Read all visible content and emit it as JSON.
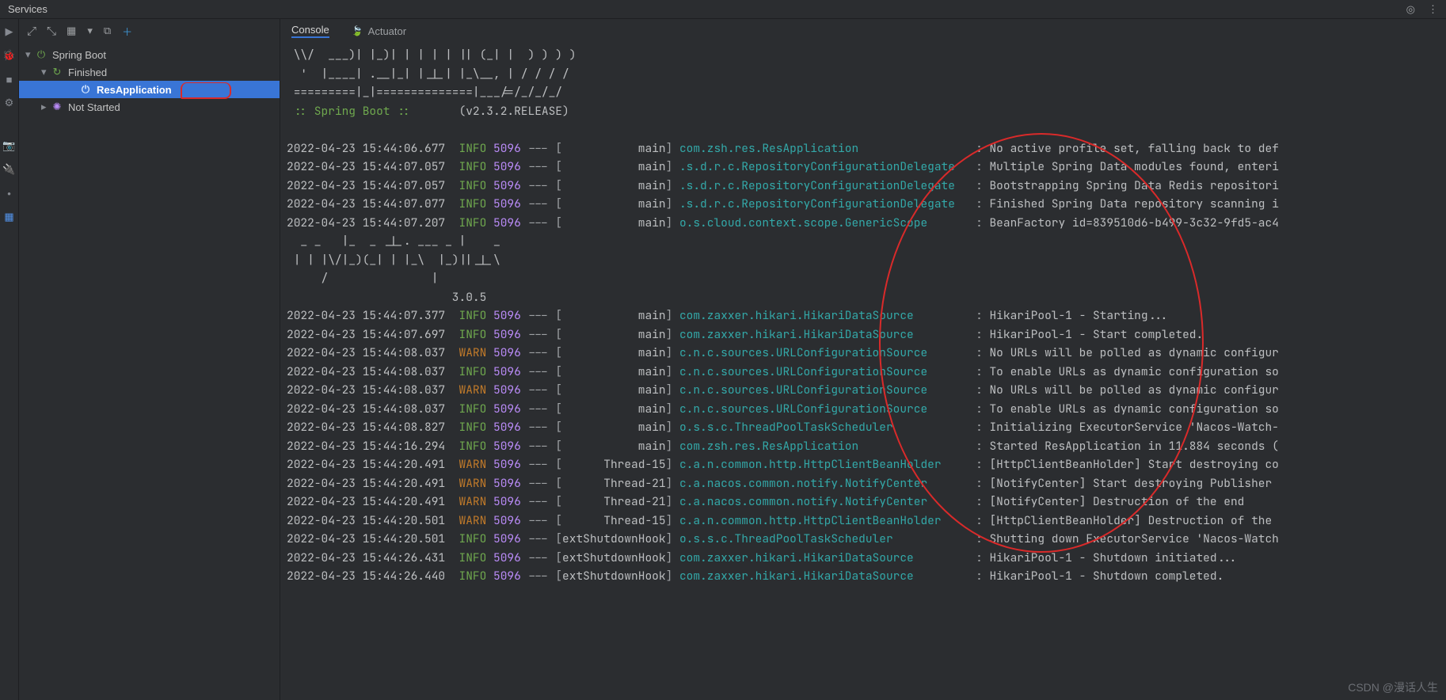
{
  "title": "Services",
  "tabs": {
    "console": "Console",
    "actuator": "Actuator"
  },
  "tree": {
    "spring_boot": "Spring Boot",
    "finished": "Finished",
    "res_app": "ResApplication",
    "not_started": "Not Started"
  },
  "banner": {
    "l1": " \\\\/  ___)| |_)| | | | | || (_| |  ) ) ) )",
    "l2": "  '  |____| .__|_| |_|_| |_\\__, | / / / /",
    "l3": " =========|_|==============|___/=/_/_/_/",
    "l4a": " :: Spring Boot :: ",
    "l4b": "      (v2.3.2.RELEASE)",
    "a1": "  _ _   |_  _ _|_. ___ _ |    _ ",
    "a2": " | | |\\/|_)(_| | |_\\  |_)||_|_\\ ",
    "a3": "     /               |         ",
    "a4": "                        3.0.5 "
  },
  "logs": [
    {
      "ts": "2022-04-23 15:44:06.677",
      "lv": "INFO",
      "pid": "5096",
      "thr": "           main",
      "cls": "com.zsh.res.ResApplication                 ",
      "msg": "No active profile set, falling back to def"
    },
    {
      "ts": "2022-04-23 15:44:07.057",
      "lv": "INFO",
      "pid": "5096",
      "thr": "           main",
      "cls": ".s.d.r.c.RepositoryConfigurationDelegate   ",
      "msg": "Multiple Spring Data modules found, enteri"
    },
    {
      "ts": "2022-04-23 15:44:07.057",
      "lv": "INFO",
      "pid": "5096",
      "thr": "           main",
      "cls": ".s.d.r.c.RepositoryConfigurationDelegate   ",
      "msg": "Bootstrapping Spring Data Redis repositori"
    },
    {
      "ts": "2022-04-23 15:44:07.077",
      "lv": "INFO",
      "pid": "5096",
      "thr": "           main",
      "cls": ".s.d.r.c.RepositoryConfigurationDelegate   ",
      "msg": "Finished Spring Data repository scanning i"
    },
    {
      "ts": "2022-04-23 15:44:07.207",
      "lv": "INFO",
      "pid": "5096",
      "thr": "           main",
      "cls": "o.s.cloud.context.scope.GenericScope       ",
      "msg": "BeanFactory id=839510d6-b499-3c32-9fd5-ac4"
    },
    {
      "ts": "2022-04-23 15:44:07.377",
      "lv": "INFO",
      "pid": "5096",
      "thr": "           main",
      "cls": "com.zaxxer.hikari.HikariDataSource         ",
      "msg": "HikariPool-1 - Starting..."
    },
    {
      "ts": "2022-04-23 15:44:07.697",
      "lv": "INFO",
      "pid": "5096",
      "thr": "           main",
      "cls": "com.zaxxer.hikari.HikariDataSource         ",
      "msg": "HikariPool-1 - Start completed."
    },
    {
      "ts": "2022-04-23 15:44:08.037",
      "lv": "WARN",
      "pid": "5096",
      "thr": "           main",
      "cls": "c.n.c.sources.URLConfigurationSource       ",
      "msg": "No URLs will be polled as dynamic configur"
    },
    {
      "ts": "2022-04-23 15:44:08.037",
      "lv": "INFO",
      "pid": "5096",
      "thr": "           main",
      "cls": "c.n.c.sources.URLConfigurationSource       ",
      "msg": "To enable URLs as dynamic configuration so"
    },
    {
      "ts": "2022-04-23 15:44:08.037",
      "lv": "WARN",
      "pid": "5096",
      "thr": "           main",
      "cls": "c.n.c.sources.URLConfigurationSource       ",
      "msg": "No URLs will be polled as dynamic configur"
    },
    {
      "ts": "2022-04-23 15:44:08.037",
      "lv": "INFO",
      "pid": "5096",
      "thr": "           main",
      "cls": "c.n.c.sources.URLConfigurationSource       ",
      "msg": "To enable URLs as dynamic configuration so"
    },
    {
      "ts": "2022-04-23 15:44:08.827",
      "lv": "INFO",
      "pid": "5096",
      "thr": "           main",
      "cls": "o.s.s.c.ThreadPoolTaskScheduler            ",
      "msg": "Initializing ExecutorService 'Nacos-Watch-"
    },
    {
      "ts": "2022-04-23 15:44:16.294",
      "lv": "INFO",
      "pid": "5096",
      "thr": "           main",
      "cls": "com.zsh.res.ResApplication                 ",
      "msg": "Started ResApplication in 11.884 seconds ("
    },
    {
      "ts": "2022-04-23 15:44:20.491",
      "lv": "WARN",
      "pid": "5096",
      "thr": "      Thread-15",
      "cls": "c.a.n.common.http.HttpClientBeanHolder     ",
      "msg": "[HttpClientBeanHolder] Start destroying co"
    },
    {
      "ts": "2022-04-23 15:44:20.491",
      "lv": "WARN",
      "pid": "5096",
      "thr": "      Thread-21",
      "cls": "c.a.nacos.common.notify.NotifyCenter       ",
      "msg": "[NotifyCenter] Start destroying Publisher"
    },
    {
      "ts": "2022-04-23 15:44:20.491",
      "lv": "WARN",
      "pid": "5096",
      "thr": "      Thread-21",
      "cls": "c.a.nacos.common.notify.NotifyCenter       ",
      "msg": "[NotifyCenter] Destruction of the end"
    },
    {
      "ts": "2022-04-23 15:44:20.501",
      "lv": "WARN",
      "pid": "5096",
      "thr": "      Thread-15",
      "cls": "c.a.n.common.http.HttpClientBeanHolder     ",
      "msg": "[HttpClientBeanHolder] Destruction of the"
    },
    {
      "ts": "2022-04-23 15:44:20.501",
      "lv": "INFO",
      "pid": "5096",
      "thr": "extShutdownHook",
      "cls": "o.s.s.c.ThreadPoolTaskScheduler            ",
      "msg": "Shutting down ExecutorService 'Nacos-Watch"
    },
    {
      "ts": "2022-04-23 15:44:26.431",
      "lv": "INFO",
      "pid": "5096",
      "thr": "extShutdownHook",
      "cls": "com.zaxxer.hikari.HikariDataSource         ",
      "msg": "HikariPool-1 - Shutdown initiated..."
    },
    {
      "ts": "2022-04-23 15:44:26.440",
      "lv": "INFO",
      "pid": "5096",
      "thr": "extShutdownHook",
      "cls": "com.zaxxer.hikari.HikariDataSource         ",
      "msg": "HikariPool-1 - Shutdown completed."
    }
  ],
  "watermark": "CSDN @漫话人生"
}
